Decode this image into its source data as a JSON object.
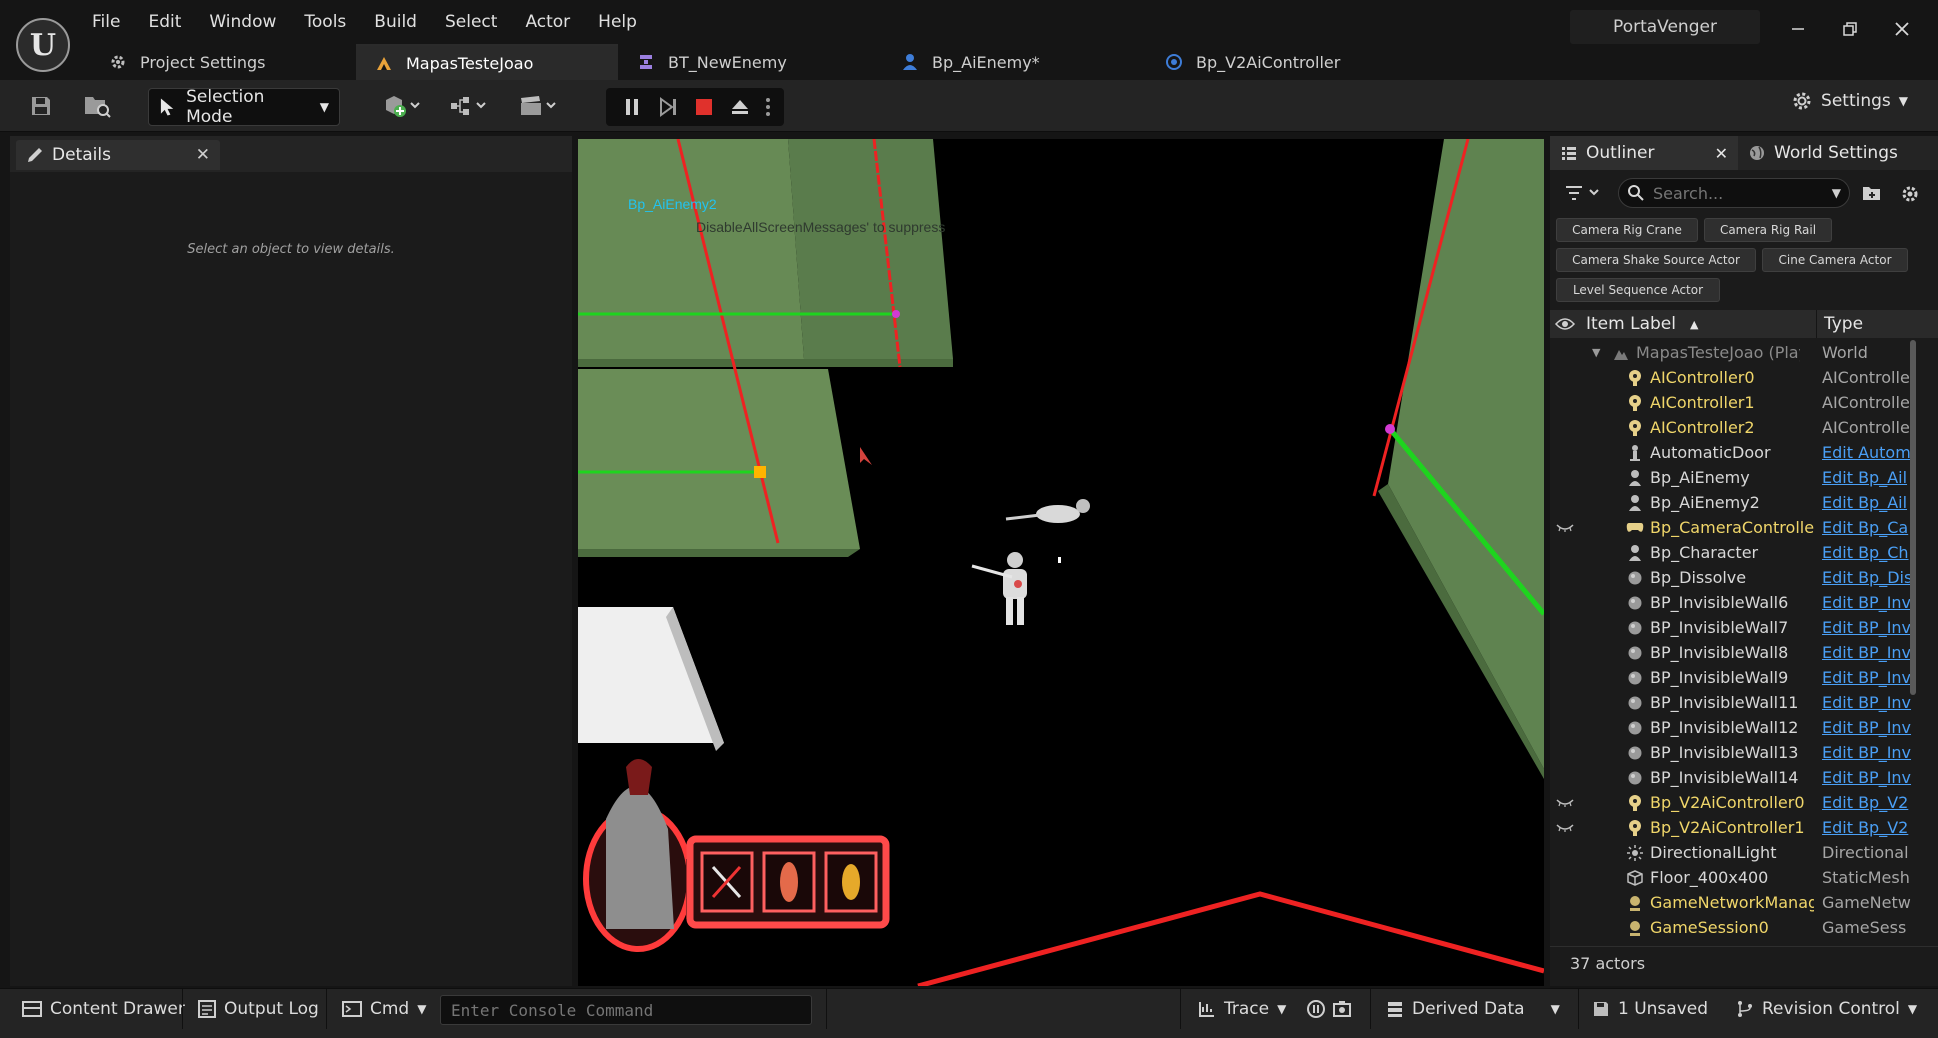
{
  "app": {
    "logo": "U",
    "project_name": "PortaVenger"
  },
  "menu": [
    "File",
    "Edit",
    "Window",
    "Tools",
    "Build",
    "Select",
    "Actor",
    "Help"
  ],
  "tabs": [
    {
      "label": "Project Settings",
      "icon": "gear-icon"
    },
    {
      "label": "MapasTesteJoao",
      "icon": "level-icon",
      "active": true
    },
    {
      "label": "BT_NewEnemy",
      "icon": "behavior-tree-icon"
    },
    {
      "label": "Bp_AiEnemy*",
      "icon": "character-blueprint-icon"
    },
    {
      "label": "Bp_V2AiController",
      "icon": "ai-controller-icon"
    }
  ],
  "toolbar": {
    "selection_mode": "Selection Mode",
    "settings": "Settings"
  },
  "details": {
    "tab_label": "Details",
    "empty_text": "Select an object to view details."
  },
  "viewport": {
    "debug_label": "Bp_AiEnemy2",
    "debug_message": "DisableAllScreenMessages' to suppress"
  },
  "outliner": {
    "tab_label": "Outliner",
    "world_settings_label": "World Settings",
    "search_placeholder": "Search...",
    "quick_add": [
      "Camera Rig Crane",
      "Camera Rig Rail",
      "Camera Shake Source Actor",
      "Cine Camera Actor",
      "Level Sequence Actor"
    ],
    "col_label": "Item Label",
    "col_type": "Type",
    "rows": [
      {
        "name": "MapasTesteJoao (Play",
        "type": "World",
        "style": "world",
        "link": false,
        "eye": false
      },
      {
        "name": "AIController0",
        "type": "AIControlle",
        "style": "yellow",
        "link": false,
        "eye": false
      },
      {
        "name": "AIController1",
        "type": "AIControlle",
        "style": "yellow",
        "link": false,
        "eye": false
      },
      {
        "name": "AIController2",
        "type": "AIControlle",
        "style": "yellow",
        "link": false,
        "eye": false
      },
      {
        "name": "AutomaticDoor",
        "type": "Edit Autom",
        "style": "normal",
        "link": true,
        "eye": false
      },
      {
        "name": "Bp_AiEnemy",
        "type": "Edit Bp_Ail",
        "style": "normal",
        "link": true,
        "eye": false
      },
      {
        "name": "Bp_AiEnemy2",
        "type": "Edit Bp_Ail",
        "style": "normal",
        "link": true,
        "eye": false
      },
      {
        "name": "Bp_CameraControlle",
        "type": "Edit Bp_Ca",
        "style": "yellow",
        "link": true,
        "eye": true
      },
      {
        "name": "Bp_Character",
        "type": "Edit Bp_Ch",
        "style": "normal",
        "link": true,
        "eye": false
      },
      {
        "name": "Bp_Dissolve",
        "type": "Edit Bp_Dis",
        "style": "normal",
        "link": true,
        "eye": false
      },
      {
        "name": "BP_InvisibleWall6",
        "type": "Edit BP_Inv",
        "style": "normal",
        "link": true,
        "eye": false
      },
      {
        "name": "BP_InvisibleWall7",
        "type": "Edit BP_Inv",
        "style": "normal",
        "link": true,
        "eye": false
      },
      {
        "name": "BP_InvisibleWall8",
        "type": "Edit BP_Inv",
        "style": "normal",
        "link": true,
        "eye": false
      },
      {
        "name": "BP_InvisibleWall9",
        "type": "Edit BP_Inv",
        "style": "normal",
        "link": true,
        "eye": false
      },
      {
        "name": "BP_InvisibleWall11",
        "type": "Edit BP_Inv",
        "style": "normal",
        "link": true,
        "eye": false
      },
      {
        "name": "BP_InvisibleWall12",
        "type": "Edit BP_Inv",
        "style": "normal",
        "link": true,
        "eye": false
      },
      {
        "name": "BP_InvisibleWall13",
        "type": "Edit BP_Inv",
        "style": "normal",
        "link": true,
        "eye": false
      },
      {
        "name": "BP_InvisibleWall14",
        "type": "Edit BP_Inv",
        "style": "normal",
        "link": true,
        "eye": false
      },
      {
        "name": "Bp_V2AiController0",
        "type": "Edit Bp_V2",
        "style": "yellow",
        "link": true,
        "eye": true
      },
      {
        "name": "Bp_V2AiController1",
        "type": "Edit Bp_V2",
        "style": "yellow",
        "link": true,
        "eye": true
      },
      {
        "name": "DirectionalLight",
        "type": "Directional",
        "style": "normal",
        "link": false,
        "eye": false
      },
      {
        "name": "Floor_400x400",
        "type": "StaticMesh",
        "style": "normal",
        "link": false,
        "eye": false
      },
      {
        "name": "GameNetworkManag",
        "type": "GameNetw",
        "style": "yellow",
        "link": false,
        "eye": false
      },
      {
        "name": "GameSession0",
        "type": "GameSess",
        "style": "yellow",
        "link": false,
        "eye": false
      }
    ],
    "actor_count": "37 actors"
  },
  "bottom": {
    "content_drawer": "Content Drawer",
    "output_log": "Output Log",
    "cmd": "Cmd",
    "console_placeholder": "Enter Console Command",
    "trace": "Trace",
    "derived_data": "Derived Data",
    "unsaved": "1 Unsaved",
    "revision_control": "Revision Control"
  },
  "colors": {
    "accent_yellow": "#f0d66a",
    "link_blue": "#4a9ff5",
    "debug_cyan": "#22c3f0",
    "wall_green": "#5a7f4c",
    "stop_red": "#e0312c"
  }
}
